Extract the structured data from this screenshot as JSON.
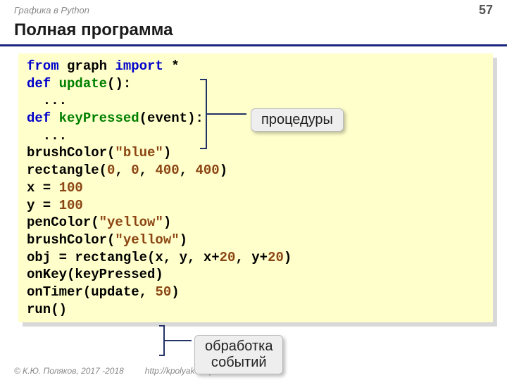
{
  "header": {
    "breadcrumb": "Графика в Python",
    "page_number": "57"
  },
  "title": "Полная программа",
  "code": {
    "l1_from": "from",
    "l1_mod": "graph",
    "l1_import": "import",
    "l1_star": "*",
    "l2_def": "def",
    "l2_name": "update",
    "l2_rest": "():",
    "l3": "  ...",
    "l4_def": "def",
    "l4_name": "keyPressed",
    "l4_rest": "(event):",
    "l5": "  ...",
    "l6a": "brushColor(",
    "l6b": "\"blue\"",
    "l6c": ")",
    "l7a": "rectangle(",
    "l7b": "0",
    "l7c": ", ",
    "l7d": "0",
    "l7e": ", ",
    "l7f": "400",
    "l7g": ", ",
    "l7h": "400",
    "l7i": ")",
    "l8a": "x = ",
    "l8b": "100",
    "l9a": "y = ",
    "l9b": "100",
    "l10a": "penColor(",
    "l10b": "\"yellow\"",
    "l10c": ")",
    "l11a": "brushColor(",
    "l11b": "\"yellow\"",
    "l11c": ")",
    "l12a": "obj = rectangle(x, y, x+",
    "l12b": "20",
    "l12c": ", y+",
    "l12d": "20",
    "l12e": ")",
    "l13": "onKey(keyPressed)",
    "l14a": "onTimer(update, ",
    "l14b": "50",
    "l14c": ")",
    "l15": "run()"
  },
  "callouts": {
    "procedures": "процедуры",
    "events": "обработка\nсобытий"
  },
  "footer": {
    "copyright": "© К.Ю. Поляков, 2017 -2018",
    "url": "http://kpolyakov.spb.ru"
  }
}
